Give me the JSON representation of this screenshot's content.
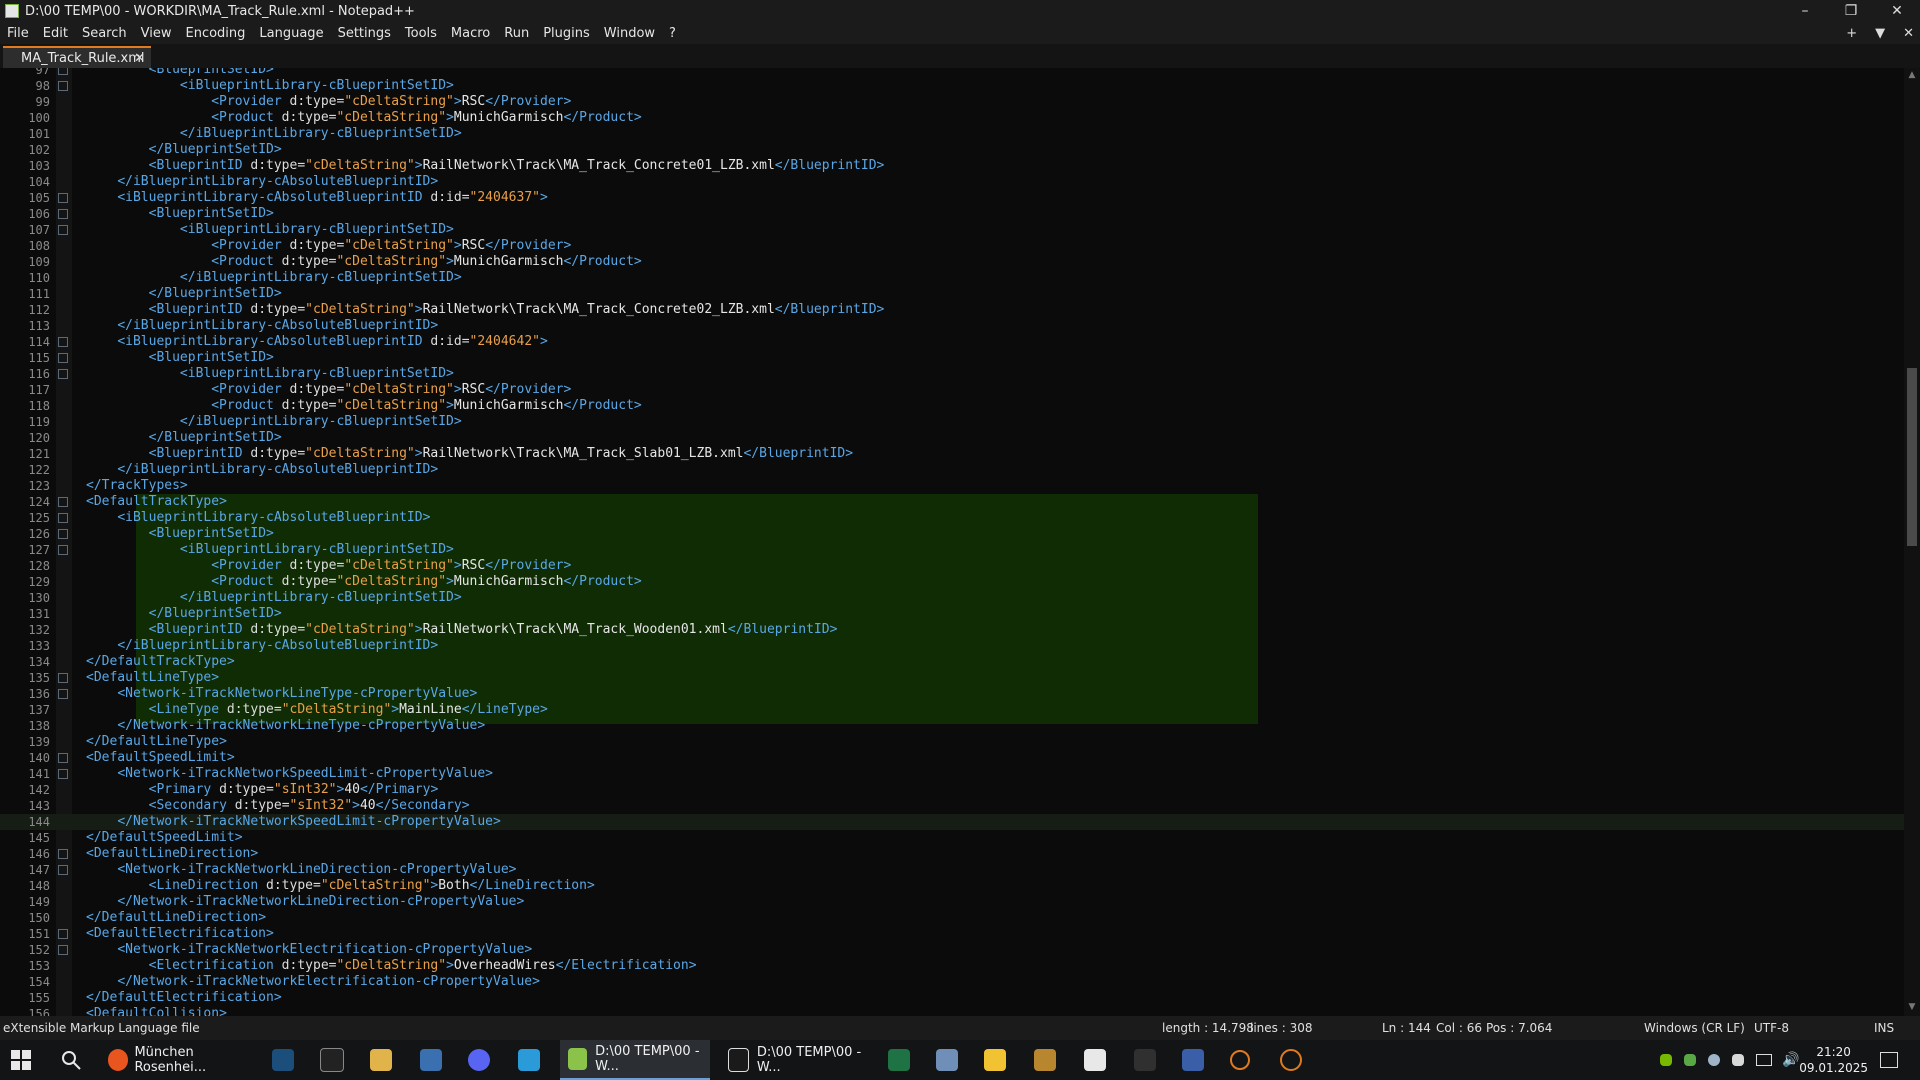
{
  "window": {
    "title": "D:\\00 TEMP\\00 - WORKDIR\\MA_Track_Rule.xml - Notepad++",
    "minimize": "–",
    "restore": "❐",
    "close": "✕"
  },
  "menu": {
    "items": [
      "File",
      "Edit",
      "Search",
      "View",
      "Encoding",
      "Language",
      "Settings",
      "Tools",
      "Macro",
      "Run",
      "Plugins",
      "Window",
      "?"
    ],
    "right_add": "+",
    "right_list": "▼",
    "right_close": "✕"
  },
  "tab": {
    "label": "MA_Track_Rule.xml",
    "close": "✕"
  },
  "editor": {
    "lines": [
      {
        "n": "97",
        "code": "        <BlueprintSetID>"
      },
      {
        "n": "98",
        "code": "            <iBlueprintLibrary-cBlueprintSetID>"
      },
      {
        "n": "99",
        "code": "                <Provider d:type=\"cDeltaString\">RSC</Provider>"
      },
      {
        "n": "100",
        "code": "                <Product d:type=\"cDeltaString\">MunichGarmisch</Product>"
      },
      {
        "n": "101",
        "code": "            </iBlueprintLibrary-cBlueprintSetID>"
      },
      {
        "n": "102",
        "code": "        </BlueprintSetID>"
      },
      {
        "n": "103",
        "code": "        <BlueprintID d:type=\"cDeltaString\">RailNetwork\\Track\\MA_Track_Concrete01_LZB.xml</BlueprintID>"
      },
      {
        "n": "104",
        "code": "    </iBlueprintLibrary-cAbsoluteBlueprintID>"
      },
      {
        "n": "105",
        "code": "    <iBlueprintLibrary-cAbsoluteBlueprintID d:id=\"2404637\">"
      },
      {
        "n": "106",
        "code": "        <BlueprintSetID>"
      },
      {
        "n": "107",
        "code": "            <iBlueprintLibrary-cBlueprintSetID>"
      },
      {
        "n": "108",
        "code": "                <Provider d:type=\"cDeltaString\">RSC</Provider>"
      },
      {
        "n": "109",
        "code": "                <Product d:type=\"cDeltaString\">MunichGarmisch</Product>"
      },
      {
        "n": "110",
        "code": "            </iBlueprintLibrary-cBlueprintSetID>"
      },
      {
        "n": "111",
        "code": "        </BlueprintSetID>"
      },
      {
        "n": "112",
        "code": "        <BlueprintID d:type=\"cDeltaString\">RailNetwork\\Track\\MA_Track_Concrete02_LZB.xml</BlueprintID>"
      },
      {
        "n": "113",
        "code": "    </iBlueprintLibrary-cAbsoluteBlueprintID>"
      },
      {
        "n": "114",
        "code": "    <iBlueprintLibrary-cAbsoluteBlueprintID d:id=\"2404642\">"
      },
      {
        "n": "115",
        "code": "        <BlueprintSetID>"
      },
      {
        "n": "116",
        "code": "            <iBlueprintLibrary-cBlueprintSetID>"
      },
      {
        "n": "117",
        "code": "                <Provider d:type=\"cDeltaString\">RSC</Provider>"
      },
      {
        "n": "118",
        "code": "                <Product d:type=\"cDeltaString\">MunichGarmisch</Product>"
      },
      {
        "n": "119",
        "code": "            </iBlueprintLibrary-cBlueprintSetID>"
      },
      {
        "n": "120",
        "code": "        </BlueprintSetID>"
      },
      {
        "n": "121",
        "code": "        <BlueprintID d:type=\"cDeltaString\">RailNetwork\\Track\\MA_Track_Slab01_LZB.xml</BlueprintID>"
      },
      {
        "n": "122",
        "code": "    </iBlueprintLibrary-cAbsoluteBlueprintID>"
      },
      {
        "n": "123",
        "code": "</TrackTypes>"
      },
      {
        "n": "124",
        "code": "<DefaultTrackType>"
      },
      {
        "n": "125",
        "code": "    <iBlueprintLibrary-cAbsoluteBlueprintID>"
      },
      {
        "n": "126",
        "code": "        <BlueprintSetID>"
      },
      {
        "n": "127",
        "code": "            <iBlueprintLibrary-cBlueprintSetID>"
      },
      {
        "n": "128",
        "code": "                <Provider d:type=\"cDeltaString\">RSC</Provider>"
      },
      {
        "n": "129",
        "code": "                <Product d:type=\"cDeltaString\">MunichGarmisch</Product>"
      },
      {
        "n": "130",
        "code": "            </iBlueprintLibrary-cBlueprintSetID>"
      },
      {
        "n": "131",
        "code": "        </BlueprintSetID>"
      },
      {
        "n": "132",
        "code": "        <BlueprintID d:type=\"cDeltaString\">RailNetwork\\Track\\MA_Track_Wooden01.xml</BlueprintID>"
      },
      {
        "n": "133",
        "code": "    </iBlueprintLibrary-cAbsoluteBlueprintID>"
      },
      {
        "n": "134",
        "code": "</DefaultTrackType>"
      },
      {
        "n": "135",
        "code": "<DefaultLineType>"
      },
      {
        "n": "136",
        "code": "    <Network-iTrackNetworkLineType-cPropertyValue>"
      },
      {
        "n": "137",
        "code": "        <LineType d:type=\"cDeltaString\">MainLine</LineType>"
      },
      {
        "n": "138",
        "code": "    </Network-iTrackNetworkLineType-cPropertyValue>"
      },
      {
        "n": "139",
        "code": "</DefaultLineType>"
      },
      {
        "n": "140",
        "code": "<DefaultSpeedLimit>"
      },
      {
        "n": "141",
        "code": "    <Network-iTrackNetworkSpeedLimit-cPropertyValue>"
      },
      {
        "n": "142",
        "code": "        <Primary d:type=\"sInt32\">40</Primary>"
      },
      {
        "n": "143",
        "code": "        <Secondary d:type=\"sInt32\">40</Secondary>"
      },
      {
        "n": "144",
        "code": "    </Network-iTrackNetworkSpeedLimit-cPropertyValue>"
      },
      {
        "n": "145",
        "code": "</DefaultSpeedLimit>"
      },
      {
        "n": "146",
        "code": "<DefaultLineDirection>"
      },
      {
        "n": "147",
        "code": "    <Network-iTrackNetworkLineDirection-cPropertyValue>"
      },
      {
        "n": "148",
        "code": "        <LineDirection d:type=\"cDeltaString\">Both</LineDirection>"
      },
      {
        "n": "149",
        "code": "    </Network-iTrackNetworkLineDirection-cPropertyValue>"
      },
      {
        "n": "150",
        "code": "</DefaultLineDirection>"
      },
      {
        "n": "151",
        "code": "<DefaultElectrification>"
      },
      {
        "n": "152",
        "code": "    <Network-iTrackNetworkElectrification-cPropertyValue>"
      },
      {
        "n": "153",
        "code": "        <Electrification d:type=\"cDeltaString\">OverheadWires</Electrification>"
      },
      {
        "n": "154",
        "code": "    </Network-iTrackNetworkElectrification-cPropertyValue>"
      },
      {
        "n": "155",
        "code": "</DefaultElectrification>"
      },
      {
        "n": "156",
        "code": "<DefaultCollision>"
      }
    ],
    "current_line": "144"
  },
  "status": {
    "file_type": "eXtensible Markup Language file",
    "length": "length : 14.798",
    "lines": "lines : 308",
    "ln": "Ln : 144",
    "col": "Col : 66",
    "pos": "Pos : 7.064",
    "eol": "Windows (CR LF)",
    "encoding": "UTF-8",
    "mode": "INS"
  },
  "taskbar": {
    "firefox_label": "München Rosenhei...",
    "npp_label": "D:\\00 TEMP\\00 - W...",
    "sevenzip_label": "D:\\00 TEMP\\00 - W...",
    "time": "21:20",
    "date": "09.01.2025"
  },
  "colors": {
    "tag": "#5aa7e6",
    "value": "#e8a04a",
    "selection": "#0f2c04",
    "tab_accent": "#e07a1f"
  }
}
